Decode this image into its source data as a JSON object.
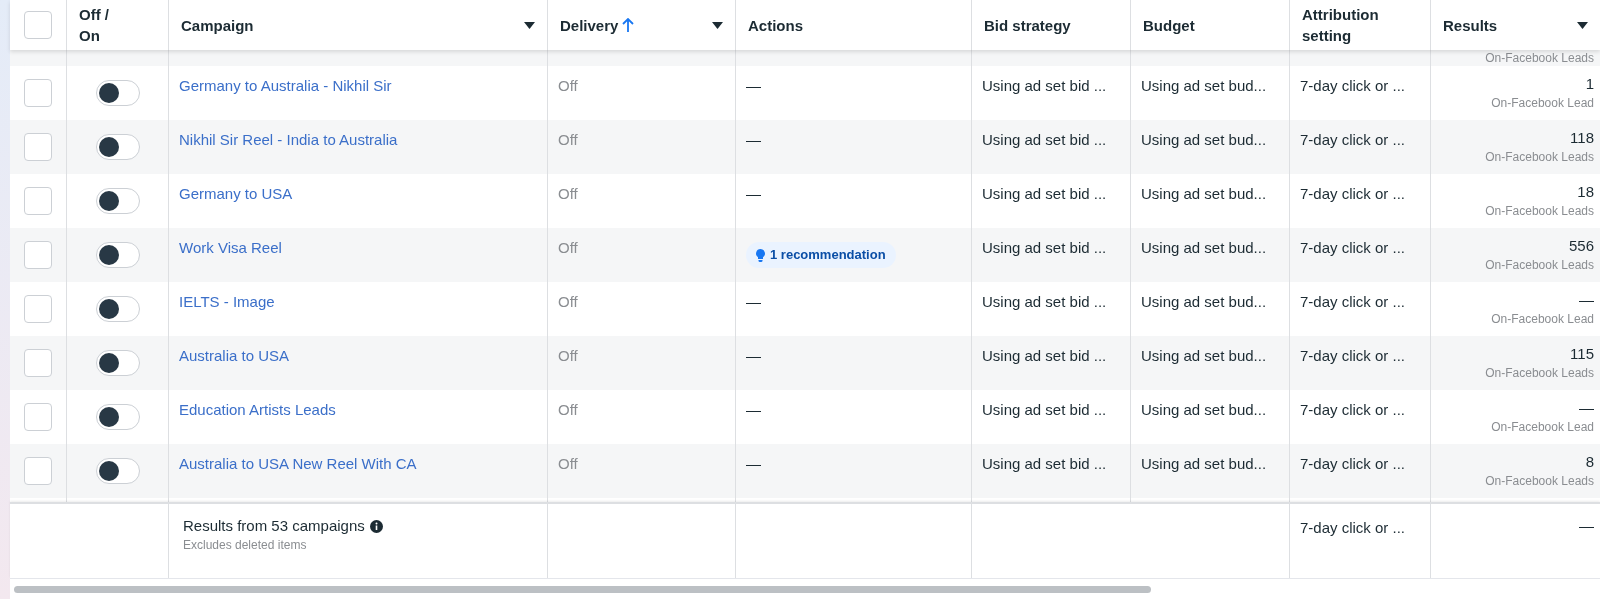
{
  "header": {
    "select_all": {
      "checked": false
    },
    "columns": [
      {
        "label": "Off / On",
        "sortable": false,
        "sorted_up": false
      },
      {
        "label": "Campaign",
        "sortable": true,
        "sorted_up": false
      },
      {
        "label": "Delivery",
        "sortable": true,
        "sorted_up": true
      },
      {
        "label": "Actions",
        "sortable": false,
        "sorted_up": false
      },
      {
        "label": "Bid strategy",
        "sortable": false,
        "sorted_up": false
      },
      {
        "label": "Budget",
        "sortable": false,
        "sorted_up": false
      },
      {
        "label": "Attribution setting",
        "sortable": false,
        "sorted_up": false
      },
      {
        "label": "Results",
        "sortable": true,
        "sorted_up": false
      }
    ]
  },
  "partial_row": {
    "results_label": "On-Facebook Leads"
  },
  "rows": [
    {
      "checked": false,
      "on": false,
      "campaign": "Germany to Australia - Nikhil Sir",
      "delivery": "Off",
      "action": {
        "kind": "none",
        "text": "—"
      },
      "bid_strategy": "Using ad set bid ...",
      "budget": "Using ad set bud...",
      "attribution": "7-day click or ...",
      "results": "1",
      "results_label": "On-Facebook Lead"
    },
    {
      "checked": false,
      "on": false,
      "campaign": "Nikhil Sir Reel - India to Australia",
      "delivery": "Off",
      "action": {
        "kind": "none",
        "text": "—"
      },
      "bid_strategy": "Using ad set bid ...",
      "budget": "Using ad set bud...",
      "attribution": "7-day click or ...",
      "results": "118",
      "results_label": "On-Facebook Leads"
    },
    {
      "checked": false,
      "on": false,
      "campaign": "Germany to USA",
      "delivery": "Off",
      "action": {
        "kind": "none",
        "text": "—"
      },
      "bid_strategy": "Using ad set bid ...",
      "budget": "Using ad set bud...",
      "attribution": "7-day click or ...",
      "results": "18",
      "results_label": "On-Facebook Leads"
    },
    {
      "checked": false,
      "on": false,
      "campaign": "Work Visa Reel",
      "delivery": "Off",
      "action": {
        "kind": "recommendation",
        "text": "1 recommendation"
      },
      "bid_strategy": "Using ad set bid ...",
      "budget": "Using ad set bud...",
      "attribution": "7-day click or ...",
      "results": "556",
      "results_label": "On-Facebook Leads"
    },
    {
      "checked": false,
      "on": false,
      "campaign": "IELTS - Image",
      "delivery": "Off",
      "action": {
        "kind": "none",
        "text": "—"
      },
      "bid_strategy": "Using ad set bid ...",
      "budget": "Using ad set bud...",
      "attribution": "7-day click or ...",
      "results": "—",
      "results_label": "On-Facebook Lead"
    },
    {
      "checked": false,
      "on": false,
      "campaign": "Australia to USA",
      "delivery": "Off",
      "action": {
        "kind": "none",
        "text": "—"
      },
      "bid_strategy": "Using ad set bid ...",
      "budget": "Using ad set bud...",
      "attribution": "7-day click or ...",
      "results": "115",
      "results_label": "On-Facebook Leads"
    },
    {
      "checked": false,
      "on": false,
      "campaign": "Education Artists Leads",
      "delivery": "Off",
      "action": {
        "kind": "none",
        "text": "—"
      },
      "bid_strategy": "Using ad set bid ...",
      "budget": "Using ad set bud...",
      "attribution": "7-day click or ...",
      "results": "—",
      "results_label": "On-Facebook Lead"
    },
    {
      "checked": false,
      "on": false,
      "campaign": "Australia to USA New Reel With CA",
      "delivery": "Off",
      "action": {
        "kind": "none",
        "text": "—"
      },
      "bid_strategy": "Using ad set bid ...",
      "budget": "Using ad set bud...",
      "attribution": "7-day click or ...",
      "results": "8",
      "results_label": "On-Facebook Leads"
    }
  ],
  "footer": {
    "summary": "Results from 53 campaigns",
    "note": "Excludes deleted items",
    "attribution": "7-day click or ...",
    "results": "—"
  }
}
